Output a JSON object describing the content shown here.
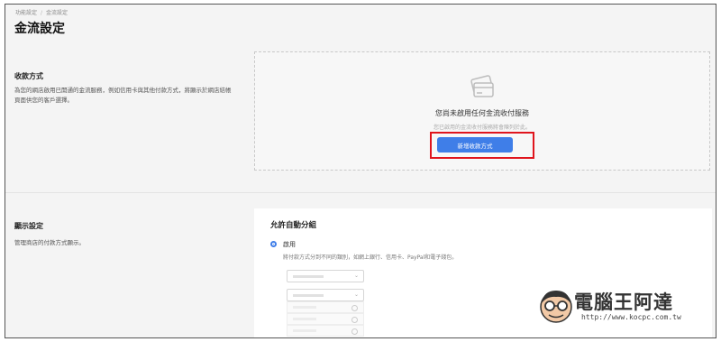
{
  "breadcrumb": {
    "parent": "功能設定",
    "current": "金流設定"
  },
  "page_title": "金流設定",
  "payment_section": {
    "heading": "收款方式",
    "description": "為您的網店啟用已開通的金流服務，例如信用卡與其他付款方式，將顯示於網店結帳頁面供您的客戶選擇。",
    "empty_title": "您尚未啟用任何金流收付服務",
    "empty_subtitle": "您已啟用的金流收付服務將會陳列於此。",
    "add_button": "新增收款方式",
    "highlight_color": "#e0151d",
    "button_color": "#3f7ee8",
    "empty_icon": "payment-card-icon"
  },
  "display_section": {
    "heading": "顯示設定",
    "description": "管理商店的付款方式顯示。",
    "card_title": "允許自動分組",
    "option_label": "啟用",
    "option_help": "將付款方式分到不同的類別，如網上銀行、信用卡、PayPal和電子錢包。",
    "option_selected": true
  },
  "watermark": {
    "name": "電腦王阿達",
    "url": "http://www.kocpc.com.tw"
  }
}
